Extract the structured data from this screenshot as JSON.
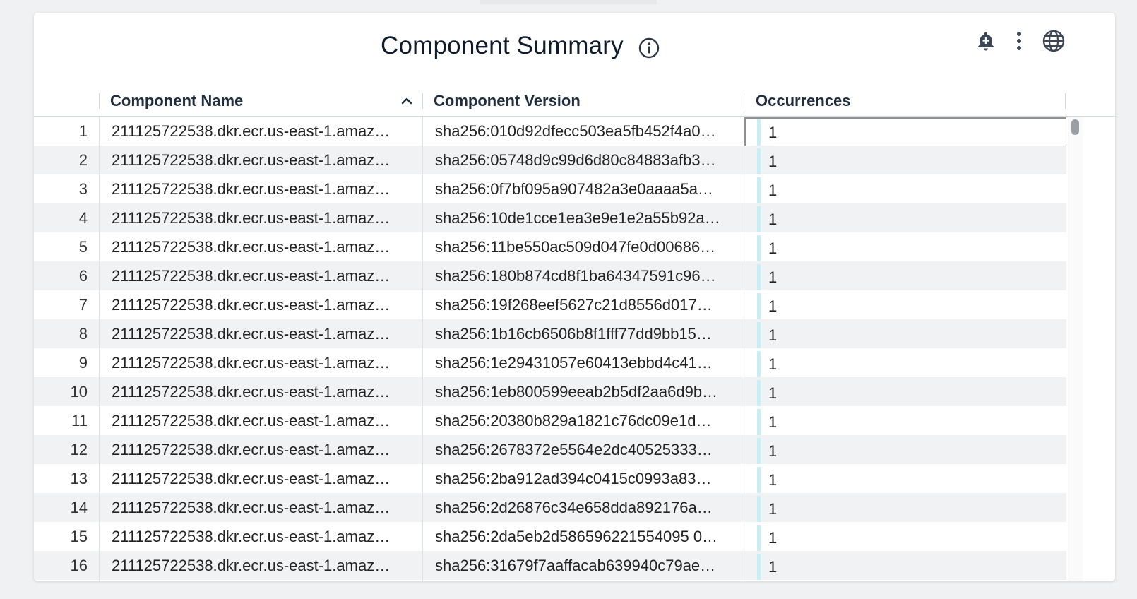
{
  "panel": {
    "title": "Component Summary"
  },
  "icons": {
    "info": "info-circle-icon",
    "alert": "bell-plus-icon",
    "menu": "more-vertical-icon",
    "globe": "globe-icon",
    "sort": "chevron-up-icon"
  },
  "table": {
    "columns": {
      "name": "Component Name",
      "version": "Component Version",
      "occurrences": "Occurrences"
    },
    "rows": [
      {
        "n": "1",
        "name": "211125722538.dkr.ecr.us-east-1.amaz…",
        "version": "sha256:010d92dfecc503ea5fb452f4a0…",
        "occ": "1"
      },
      {
        "n": "2",
        "name": "211125722538.dkr.ecr.us-east-1.amaz…",
        "version": "sha256:05748d9c99d6d80c84883afb3…",
        "occ": "1"
      },
      {
        "n": "3",
        "name": "211125722538.dkr.ecr.us-east-1.amaz…",
        "version": "sha256:0f7bf095a907482a3e0aaaa5a…",
        "occ": "1"
      },
      {
        "n": "4",
        "name": "211125722538.dkr.ecr.us-east-1.amaz…",
        "version": "sha256:10de1cce1ea3e9e1e2a55b92a…",
        "occ": "1"
      },
      {
        "n": "5",
        "name": "211125722538.dkr.ecr.us-east-1.amaz…",
        "version": "sha256:11be550ac509d047fe0d00686…",
        "occ": "1"
      },
      {
        "n": "6",
        "name": "211125722538.dkr.ecr.us-east-1.amaz…",
        "version": "sha256:180b874cd8f1ba64347591c96…",
        "occ": "1"
      },
      {
        "n": "7",
        "name": "211125722538.dkr.ecr.us-east-1.amaz…",
        "version": "sha256:19f268eef5627c21d8556d017…",
        "occ": "1"
      },
      {
        "n": "8",
        "name": "211125722538.dkr.ecr.us-east-1.amaz…",
        "version": "sha256:1b16cb6506b8f1fff77dd9bb15…",
        "occ": "1"
      },
      {
        "n": "9",
        "name": "211125722538.dkr.ecr.us-east-1.amaz…",
        "version": "sha256:1e29431057e60413ebbd4c41…",
        "occ": "1"
      },
      {
        "n": "10",
        "name": "211125722538.dkr.ecr.us-east-1.amaz…",
        "version": "sha256:1eb800599eeab2b5df2aa6d9b…",
        "occ": "1"
      },
      {
        "n": "11",
        "name": "211125722538.dkr.ecr.us-east-1.amaz…",
        "version": "sha256:20380b829a1821c76dc09e1d…",
        "occ": "1"
      },
      {
        "n": "12",
        "name": "211125722538.dkr.ecr.us-east-1.amaz…",
        "version": "sha256:2678372e5564e2dc40525333…",
        "occ": "1"
      },
      {
        "n": "13",
        "name": "211125722538.dkr.ecr.us-east-1.amaz…",
        "version": "sha256:2ba912ad394c0415c0993a83…",
        "occ": "1"
      },
      {
        "n": "14",
        "name": "211125722538.dkr.ecr.us-east-1.amaz…",
        "version": "sha256:2d26876c34e658dda892176a…",
        "occ": "1"
      },
      {
        "n": "15",
        "name": "211125722538.dkr.ecr.us-east-1.amaz…",
        "version": "sha256:2da5eb2d586596221554095 0…",
        "occ": "1"
      },
      {
        "n": "16",
        "name": "211125722538.dkr.ecr.us-east-1.amaz…",
        "version": "sha256:31679f7aaffacab639940c79ae…",
        "occ": "1"
      }
    ]
  }
}
